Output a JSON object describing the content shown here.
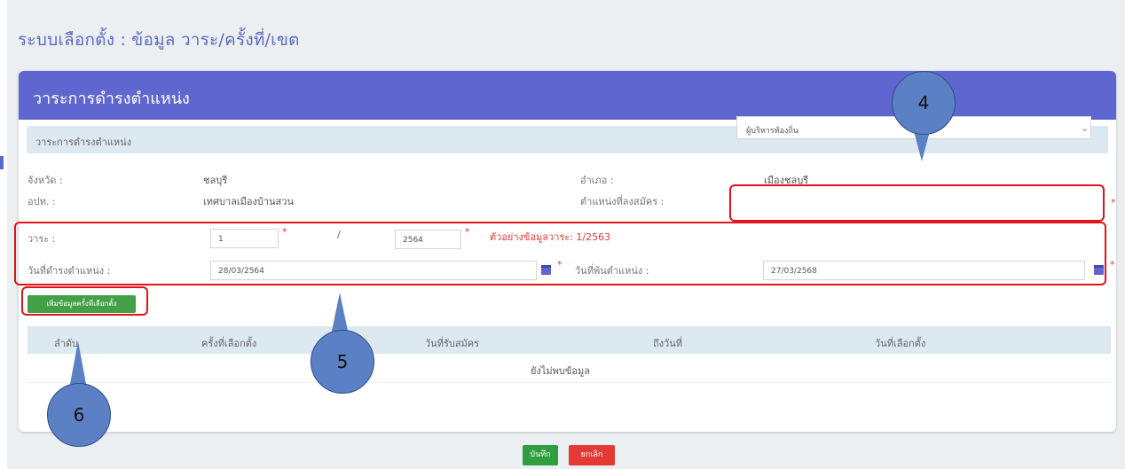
{
  "page_title": "ระบบเลือกตั้ง : ข้อมูล วาระ/ครั้งที่/เขต",
  "card": {
    "title": "วาระการดำรงตำแหน่ง",
    "section_label": "วาระการดำรงตำแหน่ง"
  },
  "form": {
    "province_label": "จังหวัด :",
    "province_value": "ชลบุรี",
    "district_label": "อำเภอ :",
    "district_value": "เมืองชลบุรี",
    "org_label": "อปท. :",
    "org_value": "เทศบาลเมืองบ้านสวน",
    "position_label": "ตำแหน่งที่ลงสมัคร :",
    "position_value": "ผู้บริหารท้องถิ่น",
    "term_label": "วาระ :",
    "term_number": "1",
    "term_separator": "/",
    "term_year": "2564",
    "term_example": "ตัวอย่างข้อมูลวาระ: 1/2563",
    "start_date_label": "วันที่ดำรงตำแหน่ง :",
    "start_date_value": "28/03/2564",
    "end_date_label": "วันที่พ้นตำแหน่ง :",
    "end_date_value": "27/03/2568",
    "required_mark": "*"
  },
  "add_button_label": "เพิ่มข้อมูลครั้งที่เลือกตั้ง",
  "table": {
    "columns": [
      "ลำดับ",
      "ครั้งที่เลือกตั้ง",
      "วันที่รับสมัคร",
      "ถึงวันที่",
      "วันที่เลือกตั้ง"
    ],
    "empty_text": "ยังไม่พบข้อมูล"
  },
  "buttons": {
    "save": "บันทึก",
    "cancel": "ยกเลิก"
  },
  "callouts": [
    "4",
    "5",
    "6"
  ],
  "colors": {
    "header": "#5f66cf",
    "title": "#5c6bc0",
    "section_bg": "#dde9f1",
    "highlight": "#e0141b",
    "add_button": "#43a047",
    "save_button": "#2e9e3f",
    "cancel_button": "#e53935",
    "callout": "#5b80c4"
  }
}
